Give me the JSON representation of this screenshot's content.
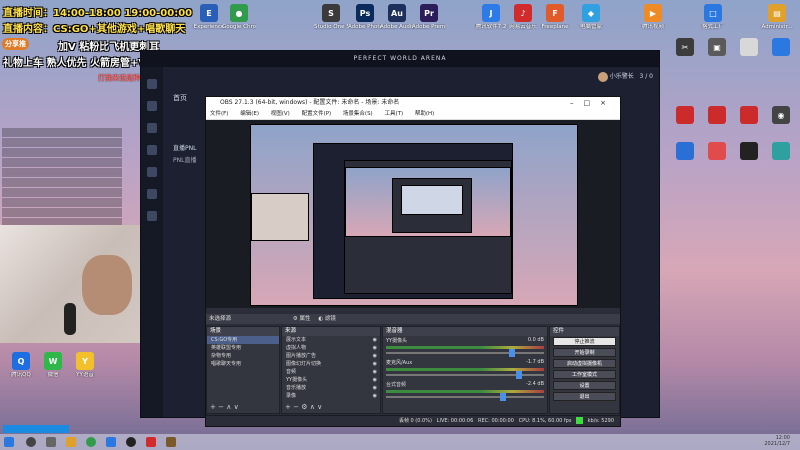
{
  "overlay": {
    "line1": "直播时间：14:00-18:00 19:00-00:00",
    "line2": "直播内容：CS:GO+其他游戏+唱歌聊天",
    "badge": "分享推",
    "line3": "加V 粘粉比飞机更刺耳",
    "line4": "礼物上车 熟人优先 火箭房管+V",
    "pink": "打我来说是种解脱",
    "chat_items": [
      "",
      "",
      "",
      "",
      "",
      "",
      "",
      "",
      "",
      ""
    ]
  },
  "desktop_icons": [
    {
      "label": "Experience",
      "color": "#2a5fb8"
    },
    {
      "label": "Google Chrome",
      "color": "#2f9b4b"
    },
    {
      "label": "Studio One 5",
      "color": "#3a3a3a"
    },
    {
      "label": "Adobe Photosh...",
      "color": "#0b2a5c"
    },
    {
      "label": "Adobe Audition ...",
      "color": "#1d2f5a"
    },
    {
      "label": "Adobe Premiere P...",
      "color": "#2c1d5a"
    },
    {
      "label": "腾讯软件7.2",
      "color": "#2d7be6"
    },
    {
      "label": "网易云音乐",
      "color": "#d22b2b"
    },
    {
      "label": "Freeplane",
      "color": "#e05a2a"
    },
    {
      "label": "电脑管家",
      "color": "#2fa0e0"
    },
    {
      "label": "腾讯视频",
      "color": "#f08a24"
    },
    {
      "label": "格式工厂",
      "color": "#2b78e0"
    },
    {
      "label": "Administr...",
      "color": "#e0a12b"
    }
  ],
  "pwa": {
    "title": "PERFECT WORLD ARENA",
    "nav_home": "首页",
    "user": "小乐警长",
    "level": "3 / 0",
    "live_label": "直播PNL",
    "pnl": "PNL直播"
  },
  "obs": {
    "title": "OBS 27.1.3 (64-bit, windows) - 配置文件: 未命名 - 场景: 未命名",
    "menu": [
      "文件(F)",
      "编辑(E)",
      "视图(V)",
      "配置文件(P)",
      "场景集合(S)",
      "工具(T)",
      "帮助(H)"
    ],
    "bar_label": "未选择源",
    "props": "属性",
    "filters": "滤镜",
    "docks": {
      "scenes": {
        "title": "场景",
        "items": [
          "CS:GO专用",
          "英雄联盟专用",
          "杂物专用",
          "唱歌聊天专用",
          "",
          "",
          ""
        ],
        "selected": 0
      },
      "sources": {
        "title": "来源",
        "items": [
          "展示文本",
          "虚拟人物",
          "图片播放广告",
          "图像幻灯片切换",
          "音频",
          "YY摄像头",
          "音乐播放",
          "录像"
        ]
      },
      "mixer": {
        "title": "混音器",
        "channels": [
          {
            "name": "YY摄像头",
            "db": "0.0 dB"
          },
          {
            "name": "麦克风/Aux",
            "db": "-1.7 dB"
          },
          {
            "name": "台式音频",
            "db": "-2.4 dB"
          }
        ]
      },
      "controls": {
        "title": "控件",
        "buttons": [
          "停止推流",
          "开始录制",
          "启动虚拟摄像机",
          "工作室模式",
          "设置",
          "退出"
        ]
      }
    },
    "status": {
      "dropped": "丢帧 0 (0.0%)",
      "live": "LIVE: 00:00:06",
      "rec": "REC: 00:00:00",
      "cpu": "CPU: 8.1%, 60.00 fps",
      "kbps": "kb/s: 5290"
    }
  },
  "taskbar": {
    "time": "12:00",
    "date": "2021/12/7"
  },
  "bottom_icons": [
    {
      "label": "腾讯QQ",
      "color": "#1d6ee0"
    },
    {
      "label": "微信",
      "color": "#2fb84a"
    },
    {
      "label": "YY语音",
      "color": "#f2c02a"
    }
  ]
}
